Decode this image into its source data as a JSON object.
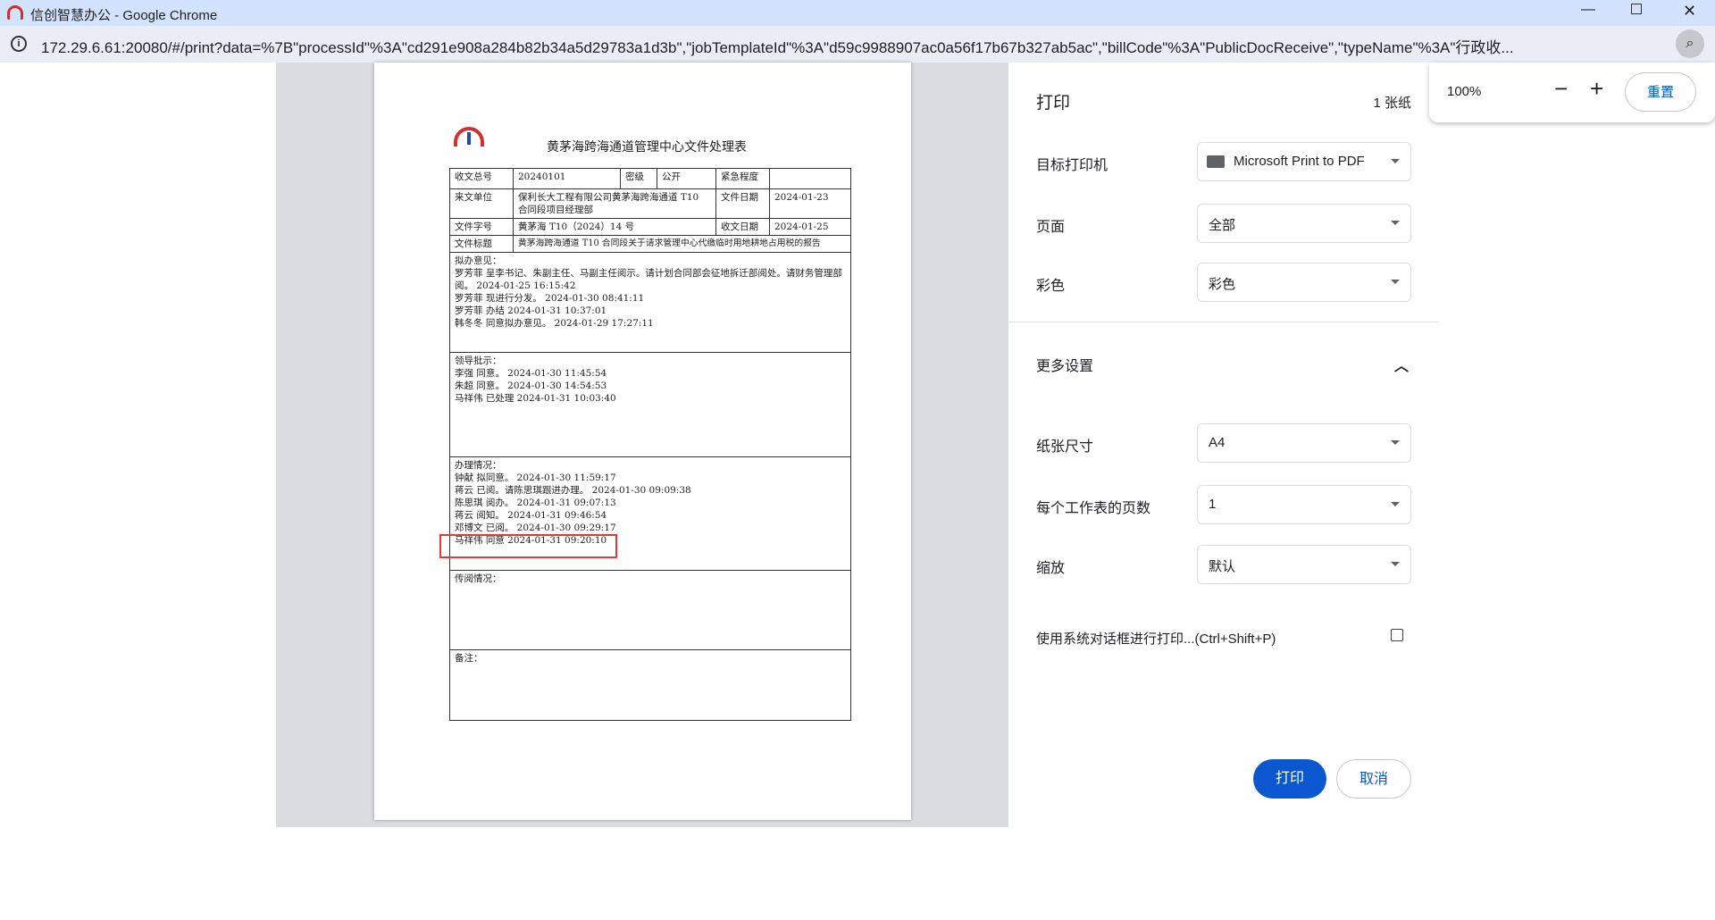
{
  "window": {
    "title": "信创智慧办公 - Google Chrome"
  },
  "address_bar": {
    "url": "172.29.6.61:20080/#/print?data=%7B\"processId\"%3A\"cd291e908a284b82b34a5d29783a1d3b\",\"jobTemplateId\"%3A\"d59c9988907ac0a56f17b67b327ab5ac\",\"billCode\"%3A\"PublicDocReceive\",\"typeName\"%3A\"行政收..."
  },
  "zoom_popup": {
    "level": "100%",
    "minus": "−",
    "plus": "+",
    "reset": "重置"
  },
  "document": {
    "title": "黄茅海跨海通道管理中心文件处理表",
    "rows": {
      "serial_label": "收文总号",
      "serial": "20240101",
      "secret_label": "密级",
      "secret": "公开",
      "urgency_label": "紧急程度",
      "urgency": "",
      "from_label": "来文单位",
      "from": "保利长大工程有限公司黄茅海跨海通道 T10 合同段项目经理部",
      "file_date_label": "文件日期",
      "file_date": "2024-01-23",
      "doc_no_label": "文件字号",
      "doc_no": "黄茅海 T10（2024）14 号",
      "recv_date_label": "收文日期",
      "recv_date": "2024-01-25",
      "subject_label": "文件标题",
      "subject": "黄茅海跨海通道 T10 合同段关于请求管理中心代缴临时用地耕地占用税的报告"
    },
    "proposal": {
      "heading": "拟办意见：",
      "lines": [
        "罗芳菲 呈李书记、朱副主任、马副主任阅示。请计划合同部会征地拆迁部阅处。请财务管理部阅。 2024-01-25 16:15:42",
        "罗芳菲 现进行分发。 2024-01-30 08:41:11",
        "罗芳菲 办结 2024-01-31 10:37:01",
        "韩冬冬 同意拟办意见。 2024-01-29 17:27:11"
      ]
    },
    "leader": {
      "heading": "领导批示：",
      "lines": [
        "李强 同意。 2024-01-30 11:45:54",
        "朱超 同意。 2024-01-30 14:54:53",
        "马祥伟 已处理 2024-01-31 10:03:40"
      ]
    },
    "handling": {
      "heading": "办理情况：",
      "lines": [
        "钟献 拟同意。 2024-01-30 11:59:17",
        "蒋云 已阅。请陈思琪跟进办理。 2024-01-30 09:09:38",
        "陈思琪 阅办。 2024-01-31 09:07:13",
        "蒋云 阅知。 2024-01-31 09:46:54",
        "邓博文 已阅。 2024-01-30 09:29:17",
        "马祥伟 同意 2024-01-31 09:20:10"
      ],
      "highlight_color": "#e53935"
    },
    "circulation": {
      "heading": "传阅情况："
    },
    "remarks": {
      "heading": "备注："
    }
  },
  "print_panel": {
    "title": "打印",
    "sheets": "1 张纸",
    "destination": {
      "label": "目标打印机",
      "value": "Microsoft Print to PDF"
    },
    "pages": {
      "label": "页面",
      "value": "全部"
    },
    "color": {
      "label": "彩色",
      "value": "彩色"
    },
    "more_settings": "更多设置",
    "paper_size": {
      "label": "纸张尺寸",
      "value": "A4"
    },
    "pages_per_sheet": {
      "label": "每个工作表的页数",
      "value": "1"
    },
    "scale": {
      "label": "缩放",
      "value": "默认"
    },
    "system_dialog": "使用系统对话框进行打印...(Ctrl+Shift+P)",
    "print_button": "打印",
    "cancel_button": "取消",
    "accent": "#0b57d0"
  }
}
